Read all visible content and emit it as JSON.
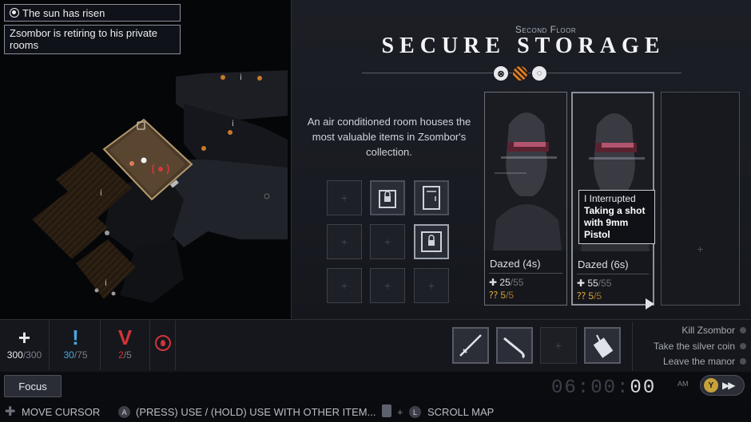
{
  "notifications": [
    {
      "text": "The sun has risen",
      "icon": "sun-icon"
    },
    {
      "text": "Zsombor is retiring to his private rooms"
    }
  ],
  "room": {
    "floor": "Second Floor",
    "title": "SECURE STORAGE",
    "description": "An air conditioned room houses the most valuable items in Zsombor's collection.",
    "icons": [
      "disable-icon",
      "striped-icon",
      "light-icon"
    ]
  },
  "storage_slots": {
    "slot_plus": "+",
    "filled_icons": [
      "locked-case-icon",
      "cabinet-icon",
      "locked-safe-icon"
    ]
  },
  "characters": [
    {
      "status": "Dazed (4s)",
      "hp": "25",
      "hp_max": "/55",
      "ammo": "5",
      "ammo_max": "/5"
    },
    {
      "status": "Dazed (6s)",
      "hp": "55",
      "hp_max": "/55",
      "ammo": "5",
      "ammo_max": "/5"
    }
  ],
  "empty_card_plus": "+",
  "tooltip": {
    "line1": "I Interrupted",
    "line2": "Taking a shot with 9mm Pistol"
  },
  "stats": [
    {
      "icon": "+",
      "value": "300",
      "max": "/300",
      "color": "#e8e9ec"
    },
    {
      "icon": "!",
      "value": "30",
      "max": "/75",
      "color": "#4aa8e0"
    },
    {
      "icon": "V",
      "value": "2",
      "max": "/5",
      "color": "#d0343a"
    }
  ],
  "focus_label": "Focus",
  "tools": [
    "katana-icon",
    "crowbar-icon",
    "",
    "keycard-icon"
  ],
  "objectives": [
    "Kill Zsombor",
    "Take the silver coin",
    "Leave the manor"
  ],
  "clock": {
    "dim": "06:00:",
    "lit": "00",
    "ampm": "AM",
    "button": "Y"
  },
  "controls": {
    "move": "MOVE CURSOR",
    "use_button": "A",
    "use": "(PRESS) USE  /  (HOLD) USE WITH OTHER ITEM...",
    "scroll_button": "L",
    "scroll": "SCROLL MAP"
  },
  "colors": {
    "accent_orange": "#d77d2a",
    "health_blue": "#4aa8e0",
    "danger_red": "#d0343a",
    "ammo_gold": "#d9a13a"
  }
}
